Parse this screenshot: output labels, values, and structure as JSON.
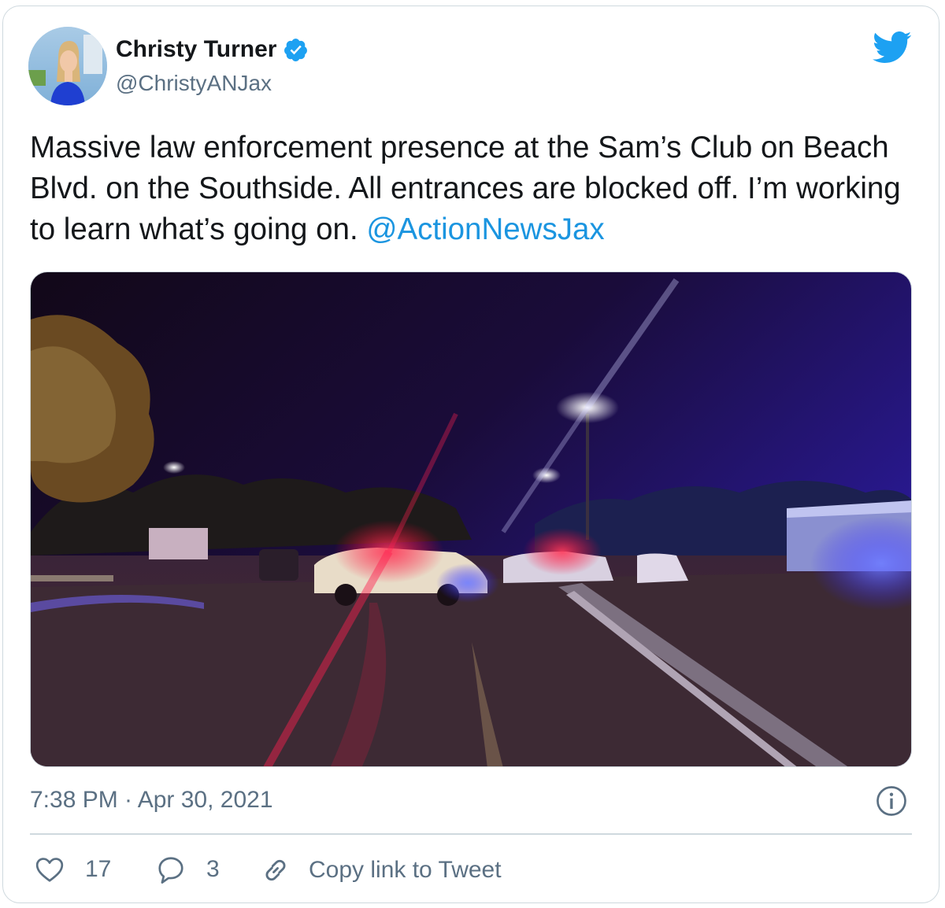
{
  "author": {
    "name": "Christy Turner",
    "handle": "@ChristyANJax",
    "verified": true
  },
  "tweet": {
    "text": "Massive law enforcement presence at the Sam’s Club on Beach Blvd. on the Southside. All entrances are blocked off. I’m working to learn what’s going on. ",
    "mention": "@ActionNewsJax",
    "timestamp": "7:38 PM · Apr 30, 2021"
  },
  "actions": {
    "likes": "17",
    "replies": "3",
    "copy_link_label": "Copy link to Tweet"
  },
  "colors": {
    "link": "#1b95e0",
    "secondary_text": "#5b7083",
    "twitter_blue": "#1da1f2",
    "border": "#cfd9de"
  },
  "icons": [
    "verified-badge-icon",
    "twitter-bird-icon",
    "info-icon",
    "heart-icon",
    "reply-bubble-icon",
    "link-icon"
  ]
}
